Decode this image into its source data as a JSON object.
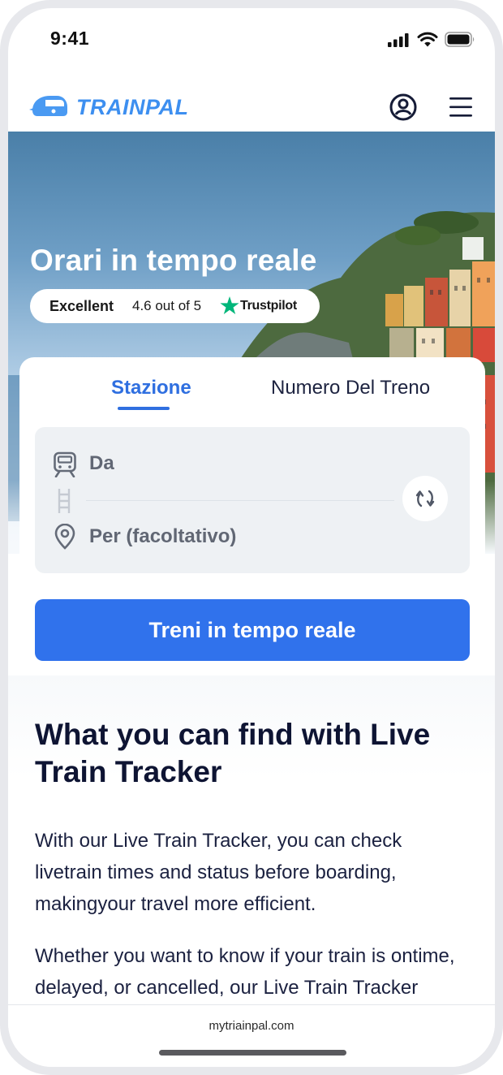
{
  "status_bar": {
    "time": "9:41"
  },
  "nav": {
    "brand": "TRAINPAL"
  },
  "hero": {
    "headline": "Orari in tempo reale",
    "trustpilot": {
      "rating_word": "Excellent",
      "score_text": "4.6 out of 5",
      "brand": "Trustpilot"
    }
  },
  "search": {
    "tabs": [
      {
        "label": "Stazione",
        "active": true
      },
      {
        "label": "Numero Del Treno",
        "active": false
      }
    ],
    "from_placeholder": "Da",
    "to_placeholder": "Per (facoltativo)",
    "submit_label": "Treni in tempo reale"
  },
  "content": {
    "heading": "What you can find with Live Train Tracker",
    "paragraphs": [
      "With our Live Train Tracker, you can check livetrain times and status before boarding, makingyour travel more efficient.",
      "Whether you want to know if your train is ontime, delayed, or cancelled, our Live Train Tracker provides real-time updates with"
    ]
  },
  "browser": {
    "url": "mytriainpal.com"
  },
  "colors": {
    "brand": "#3d8ff0",
    "primary": "#3072ec",
    "heading": "#0e1433",
    "trustpilot_green": "#00b67a"
  },
  "icons": [
    "signal-icon",
    "wifi-icon",
    "battery-icon",
    "train-logo-icon",
    "account-icon",
    "menu-icon",
    "star-icon",
    "train-icon",
    "track-icon",
    "location-pin-icon",
    "swap-icon"
  ]
}
